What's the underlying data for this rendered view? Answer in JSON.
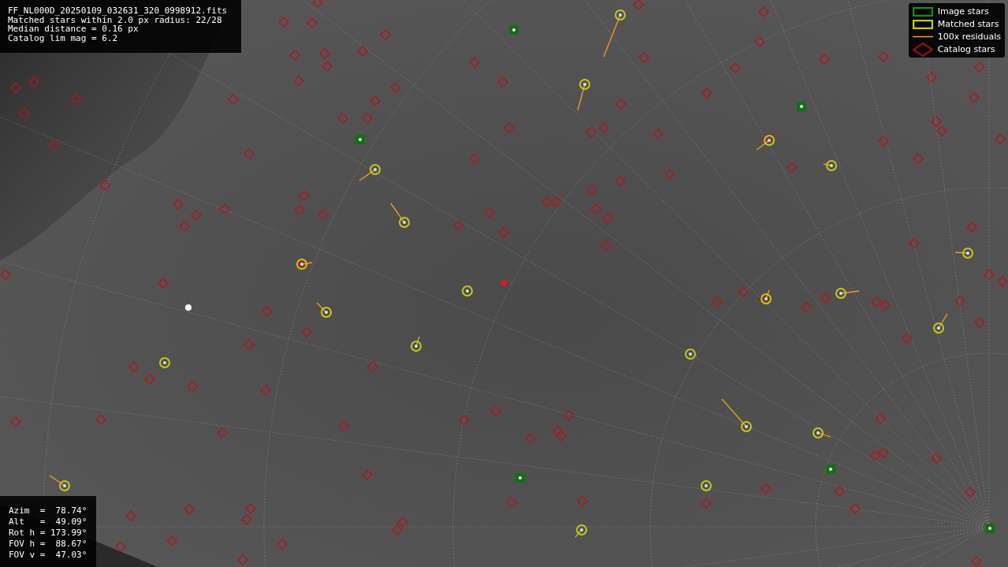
{
  "info_box": {
    "lines": [
      "FF_NL000D_20250109_032631_320_0998912.fits",
      "Matched stars within 2.0 px radius: 22/28",
      "Median distance = 0.16 px",
      "Catalog lim mag = 6.2"
    ]
  },
  "legend": [
    {
      "kind": "image",
      "label": "Image stars"
    },
    {
      "kind": "matched",
      "label": "Matched stars"
    },
    {
      "kind": "residual",
      "label": "100x residuals"
    },
    {
      "kind": "catalog",
      "label": "Catalog stars"
    }
  ],
  "pointing": {
    "lines": [
      "Azim  =  78.74°",
      "Alt   =  49.09°",
      "Rot h = 173.99°",
      "FOV h =  88.67°",
      "FOV v =  47.03°"
    ]
  }
}
